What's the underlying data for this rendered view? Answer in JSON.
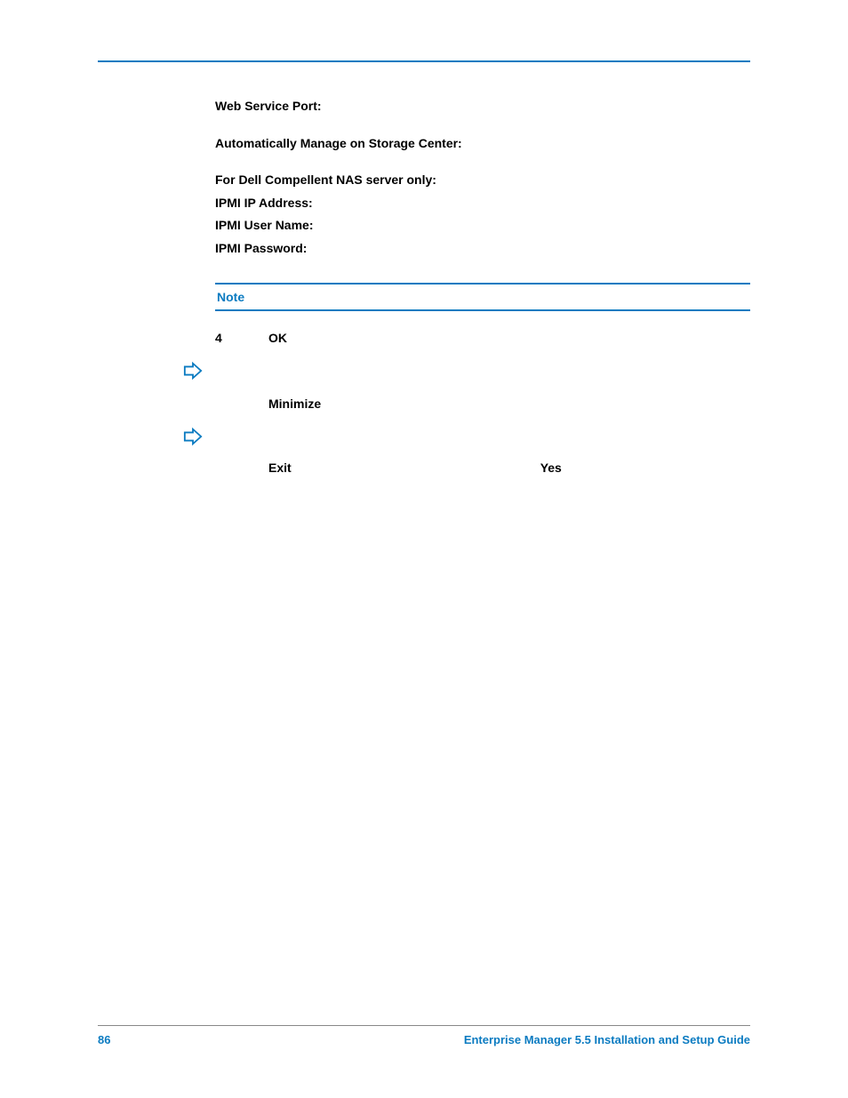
{
  "fields": {
    "web_service_port": "Web Service Port:",
    "auto_manage": "Automatically Manage on Storage Center:",
    "nas_only": "For Dell Compellent NAS server only:",
    "ipmi_ip": "IPMI IP Address:",
    "ipmi_user": "IPMI User Name:",
    "ipmi_pass": "IPMI Password:"
  },
  "note": {
    "label": "Note"
  },
  "step": {
    "number": "4",
    "text": "OK"
  },
  "actions": {
    "minimize": "Minimize",
    "exit": "Exit",
    "yes": "Yes"
  },
  "footer": {
    "page": "86",
    "title": "Enterprise Manager 5.5 Installation and Setup Guide"
  }
}
